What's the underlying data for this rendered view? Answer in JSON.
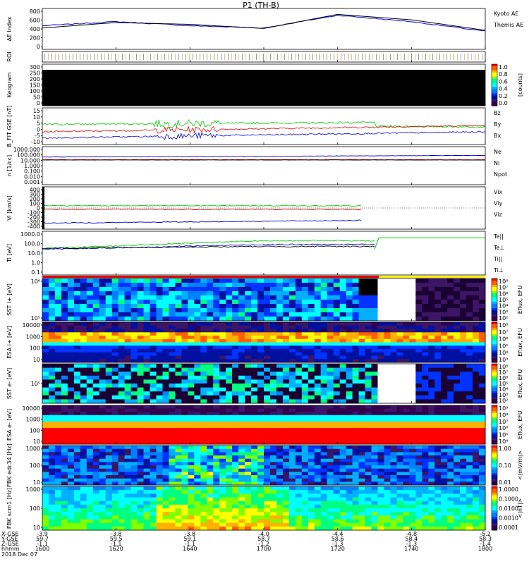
{
  "title": "P1 (TH-B)",
  "colors": {
    "blue": "#0000cc",
    "red": "#dd0000",
    "green": "#00cc00",
    "black": "#000000"
  },
  "panels": [
    {
      "id": "ae",
      "ylabel": "AE Index",
      "ticks": [
        "800",
        "600",
        "400",
        "200",
        "0"
      ],
      "legend": [
        {
          "text": "Kyoto AE",
          "color": "#0000cc"
        },
        {
          "text": "Themis AE",
          "color": "#000000"
        }
      ]
    },
    {
      "id": "roi",
      "ylabel": "ROI",
      "ticks": [],
      "legend": []
    },
    {
      "id": "keogram",
      "ylabel": "Keogram",
      "ticks": [
        "300",
        "250",
        "200",
        "150",
        "100",
        "50",
        "0"
      ],
      "legend": [],
      "colorbar": {
        "label": "[counts]",
        "ticks": [
          "1.0",
          "0.8",
          "0.6",
          "0.4",
          "0.2",
          "0.0"
        ]
      }
    },
    {
      "id": "bfit",
      "ylabel": "B_FIT GSE [nT]",
      "ticks": [
        "15",
        "10",
        "5",
        "0",
        "-5",
        "-10"
      ],
      "legend": [
        {
          "text": "Bz",
          "color": "#dd0000"
        },
        {
          "text": "By",
          "color": "#00cc00"
        },
        {
          "text": "Bx",
          "color": "#0000cc"
        }
      ]
    },
    {
      "id": "dens",
      "ylabel": "n [1/cc]",
      "ticks": [
        "1000.000",
        "100.000",
        "10.000",
        "1.000",
        "0.100",
        "0.010",
        "0.001"
      ],
      "legend": [
        {
          "text": "Ne",
          "color": "#dd0000"
        },
        {
          "text": "Ni",
          "color": "#000000"
        },
        {
          "text": "Npot",
          "color": "#0000cc"
        }
      ]
    },
    {
      "id": "vel",
      "ylabel": "Vi [km/s]",
      "ticks": [
        "400",
        "300",
        "200",
        "100",
        "0",
        "-100",
        "-200",
        "-300",
        "-400"
      ],
      "legend": [
        {
          "text": "Vix",
          "color": "#dd0000"
        },
        {
          "text": "Viy",
          "color": "#00cc00"
        },
        {
          "text": "Viz",
          "color": "#0000cc"
        }
      ]
    },
    {
      "id": "temp",
      "ylabel": "Ti [eV]",
      "ticks": [
        "1000.0",
        "100.0",
        "10.0",
        "1.0",
        "0.1"
      ],
      "legend": [
        {
          "text": "Te||",
          "color": "#000000"
        },
        {
          "text": "Te⊥",
          "color": "#dd0000"
        },
        {
          "text": "Ti||",
          "color": "#00cc00"
        },
        {
          "text": "Ti⊥",
          "color": "#0000cc"
        }
      ]
    },
    {
      "id": "sst_i",
      "ylabel": "SST i+ [eV]",
      "ticks": [
        "10⁶",
        "10⁵"
      ],
      "legend": [],
      "colorbar": {
        "label": "Eflux, EFU",
        "ticks": [
          "10⁸",
          "10⁷",
          "10⁶",
          "10⁵",
          "10⁴",
          "10³",
          "10²"
        ]
      }
    },
    {
      "id": "esa_i",
      "ylabel": "ESA i+ [eV]",
      "ticks": [
        "10000",
        "1000",
        "100",
        "10"
      ],
      "legend": [],
      "colorbar": {
        "label": "Eflux, EFU",
        "ticks": [
          "10⁸",
          "10⁷",
          "10⁶",
          "10⁵",
          "10⁴",
          "10³"
        ]
      }
    },
    {
      "id": "sst_e",
      "ylabel": "SST e- [eV]",
      "ticks": [
        "10⁵"
      ],
      "legend": [],
      "colorbar": {
        "label": "Eflux, EFU",
        "ticks": [
          "10⁸",
          "10⁷",
          "10⁶",
          "10⁵",
          "10⁴",
          "10³",
          "10²"
        ]
      }
    },
    {
      "id": "esa_e",
      "ylabel": "ESA e- [eV]",
      "ticks": [
        "10000",
        "1000",
        "100",
        "10"
      ],
      "legend": [],
      "colorbar": {
        "label": "Eflux, EFU",
        "ticks": [
          "10⁹",
          "10⁸",
          "10⁷",
          "10⁶",
          "10⁵",
          "10⁴"
        ]
      }
    },
    {
      "id": "fbk_e",
      "ylabel": "FBK edc34 [Hz]",
      "ticks": [
        "1000",
        "100",
        "10"
      ],
      "legend": [],
      "colorbar": {
        "label": "<|mV/m|>",
        "ticks": [
          "1.00",
          "0.10",
          "0.01"
        ]
      }
    },
    {
      "id": "fbk_b",
      "ylabel": "FBK scm1 [Hz]",
      "ticks": [
        "1000",
        "100",
        "10"
      ],
      "legend": [],
      "colorbar": {
        "label": "<|nT|>",
        "ticks": [
          "1.0000",
          "0.1000",
          "0.0100",
          "0.0010",
          "0.0001"
        ]
      }
    }
  ],
  "time_axis": {
    "row_labels": [
      "X-GSE",
      "Y-GSE",
      "Z-GSE",
      "hhmm",
      "2018 Dec 07"
    ],
    "columns": [
      {
        "x": "-3.9",
        "y": "59.7",
        "z": "-1.1",
        "t": "1600"
      },
      {
        "x": "-3.8",
        "y": "59.5",
        "z": "-1.1",
        "t": "1620"
      },
      {
        "x": "-3.8",
        "y": "59.1",
        "z": "-1.1",
        "t": "1640"
      },
      {
        "x": "-4.0",
        "y": "58.7",
        "z": "-1.2",
        "t": "1700"
      },
      {
        "x": "-4.4",
        "y": "58.6",
        "z": "-1.3",
        "t": "1720"
      },
      {
        "x": "-4.8",
        "y": "58.4",
        "z": "-1.3",
        "t": "1740"
      },
      {
        "x": "-5.2",
        "y": "58.3",
        "z": "-1.4",
        "t": "1800"
      }
    ]
  },
  "chart_data": {
    "type": "line",
    "title": "P1 (TH-B)",
    "xlabel": "hhmm",
    "x": [
      "1600",
      "1620",
      "1640",
      "1700",
      "1720",
      "1740",
      "1800"
    ],
    "series": [
      {
        "name": "Kyoto AE",
        "values": [
          470,
          560,
          470,
          420,
          700,
          560,
          350
        ]
      },
      {
        "name": "Themis AE",
        "values": [
          420,
          540,
          500,
          410,
          720,
          600,
          370
        ]
      }
    ],
    "ylim": [
      -50,
      850
    ]
  }
}
